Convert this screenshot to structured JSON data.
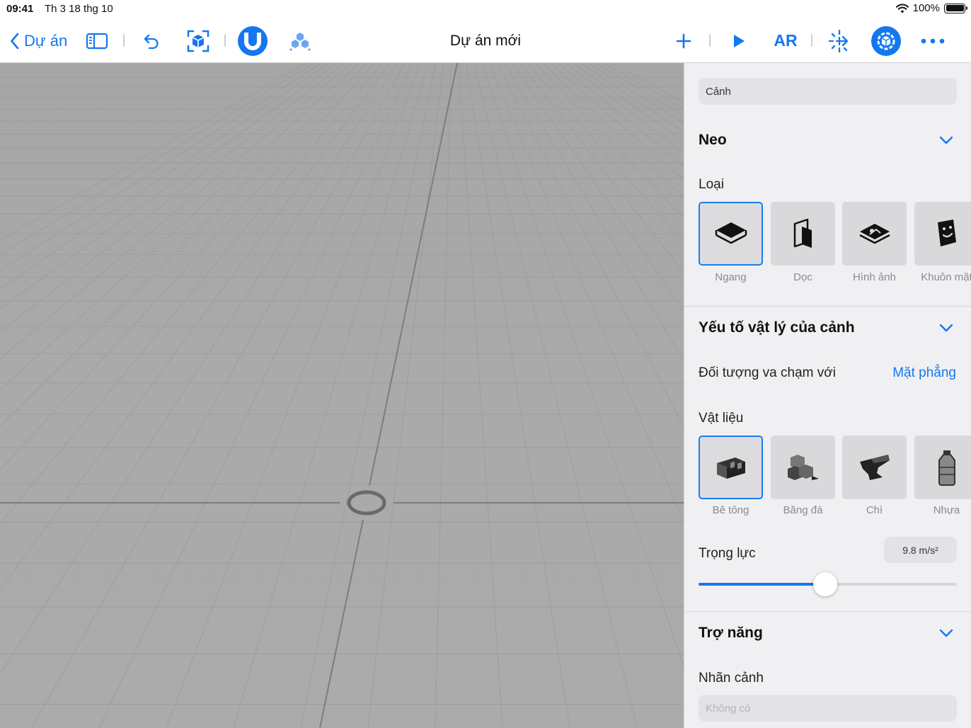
{
  "status_bar": {
    "time": "09:41",
    "date": "Th 3 18 thg 10",
    "battery": "100%",
    "battery_level": 1.0
  },
  "toolbar": {
    "back_label": "Dự án",
    "title": "Dự án mới",
    "ar_label": "AR",
    "accent_color": "#1477f0",
    "icons": [
      "chevron-left-icon",
      "sidebar-icon",
      "undo-icon",
      "box-select-icon",
      "magnet-icon",
      "scene-cubes-icon",
      "plus-icon",
      "play-icon",
      "move-arrows-icon",
      "settings-cube-icon",
      "more-icon"
    ]
  },
  "inspector": {
    "scene_field": "Cảnh",
    "anchor": {
      "title": "Neo",
      "type_label": "Loại",
      "types": [
        {
          "label": "Ngang",
          "icon": "horizontal-plane-icon",
          "selected": true
        },
        {
          "label": "Dọc",
          "icon": "vertical-plane-icon",
          "selected": false
        },
        {
          "label": "Hình ảnh",
          "icon": "image-anchor-icon",
          "selected": false
        },
        {
          "label": "Khuôn mặt",
          "icon": "face-anchor-icon",
          "selected": false
        }
      ]
    },
    "physics": {
      "title": "Yếu tố vật lý của cảnh",
      "collision_label": "Đối tượng va chạm với",
      "collision_value": "Mặt phẳng",
      "material_label": "Vật liệu",
      "materials": [
        {
          "label": "Bê tông",
          "icon": "concrete-icon",
          "selected": true
        },
        {
          "label": "Băng đá",
          "icon": "ice-cubes-icon",
          "selected": false
        },
        {
          "label": "Chì",
          "icon": "anvil-icon",
          "selected": false
        },
        {
          "label": "Nhựa",
          "icon": "plastic-bottle-icon",
          "selected": false
        }
      ],
      "gravity_label": "Trọng lực",
      "gravity_value": "9.8 m/s²",
      "gravity_slider_fraction": 0.49
    },
    "accessibility": {
      "title": "Trợ năng",
      "scene_label_title": "Nhãn cảnh",
      "scene_label_placeholder": "Không có"
    }
  }
}
